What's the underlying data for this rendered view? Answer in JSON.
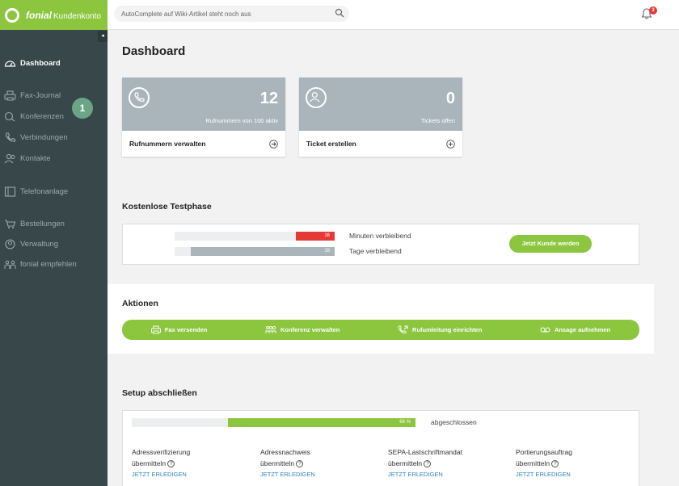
{
  "brand": {
    "name": "fonial",
    "product": "Kundenkonto"
  },
  "search": {
    "placeholder": "AutoComplete auf Wiki-Artikel steht noch aus"
  },
  "notifications": {
    "count": "3"
  },
  "sidebar": {
    "collapse_icon": "◂",
    "items": [
      {
        "label": "Dashboard",
        "icon": "speedometer-icon",
        "active": true
      },
      {
        "label": "Fax-Journal",
        "icon": "fax-icon"
      },
      {
        "label": "Konferenzen",
        "icon": "conference-icon"
      },
      {
        "label": "Verbindungen",
        "icon": "phone-icon"
      },
      {
        "label": "Kontakte",
        "icon": "contacts-icon"
      },
      {
        "label": "Telefonanlage",
        "icon": "pbx-icon"
      },
      {
        "label": "Bestellungen",
        "icon": "cart-icon"
      },
      {
        "label": "Verwaltung",
        "icon": "user-icon"
      },
      {
        "label": "fonial empfehlen",
        "icon": "people-icon"
      }
    ],
    "step_badge": "1"
  },
  "main": {
    "title": "Dashboard",
    "cards": [
      {
        "number": "12",
        "sub": "Rufnummern von 100 aktiv",
        "action": "Rufnummern verwalten",
        "icon": "phone-icon",
        "action_icon": "arrow-circle-icon"
      },
      {
        "number": "0",
        "sub": "Tickets offen",
        "action": "Ticket erstellen",
        "icon": "user-icon",
        "action_icon": "plus-circle-icon"
      }
    ],
    "trial": {
      "title": "Kostenlose Testphase",
      "minutes": {
        "value": "16",
        "label": "Minuten verbleibend",
        "fraction": 0.24,
        "color": "#e53935"
      },
      "days": {
        "value": "28",
        "label": "Tage verbleibend",
        "fraction": 0.9,
        "color": "#a9b4bb"
      },
      "cta": "Jetzt Kunde werden"
    },
    "actions": {
      "title": "Aktionen",
      "items": [
        {
          "label": "Fax versenden",
          "icon": "fax-icon"
        },
        {
          "label": "Konferenz verwalten",
          "icon": "conference-icon"
        },
        {
          "label": "Rufumleitung einrichten",
          "icon": "forward-call-icon"
        },
        {
          "label": "Ansage aufnehmen",
          "icon": "voicemail-icon"
        }
      ]
    },
    "setup": {
      "title": "Setup abschließen",
      "progress_label": "66 %",
      "progress": 0.66,
      "status": "abgeschlossen",
      "tasks": [
        {
          "line1": "Adressverifizierung",
          "line2": "übermitteln",
          "link": "JETZT ERLEDIGEN"
        },
        {
          "line1": "Adressnachweis",
          "line2": "übermitteln",
          "link": "JETZT ERLEDIGEN"
        },
        {
          "line1": "SEPA-Lastschriftmandat",
          "line2": "übermitteln",
          "link": "JETZT ERLEDIGEN"
        },
        {
          "line1": "Portierungsauftrag",
          "line2": "übermitteln",
          "link": "JETZT ERLEDIGEN"
        }
      ],
      "help_glyph": "?"
    }
  },
  "colors": {
    "brand_green": "#8cc63f",
    "sidebar": "#37474a",
    "alert_red": "#e53935"
  }
}
